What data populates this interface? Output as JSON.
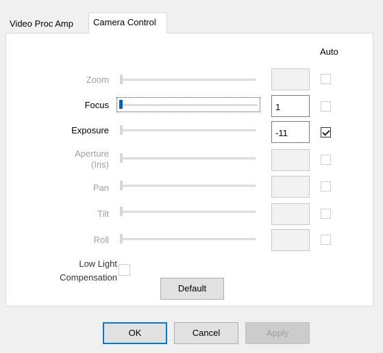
{
  "tabs": [
    {
      "label": "Video Proc Amp",
      "active": false
    },
    {
      "label": "Camera Control",
      "active": true
    }
  ],
  "auto_header": "Auto",
  "controls": [
    {
      "label": "Zoom",
      "enabled": false,
      "value": "",
      "auto_checked": false
    },
    {
      "label": "Focus",
      "enabled": true,
      "value": "1",
      "auto_checked": false
    },
    {
      "label": "Exposure",
      "enabled": true,
      "value": "-11",
      "auto_checked": true
    },
    {
      "label": "Aperture\n(Iris)",
      "enabled": false,
      "value": "",
      "auto_checked": false
    },
    {
      "label": "Pan",
      "enabled": false,
      "value": "",
      "auto_checked": false
    },
    {
      "label": "Tilt",
      "enabled": false,
      "value": "",
      "auto_checked": false
    },
    {
      "label": "Roll",
      "enabled": false,
      "value": "",
      "auto_checked": false
    }
  ],
  "low_light": {
    "label": "Low Light\nCompensation",
    "checked": false
  },
  "buttons": {
    "default": "Default",
    "ok": "OK",
    "cancel": "Cancel",
    "apply": "Apply"
  },
  "colors": {
    "accent": "#0078d7",
    "slider_thumb_active": "#0063c6"
  }
}
